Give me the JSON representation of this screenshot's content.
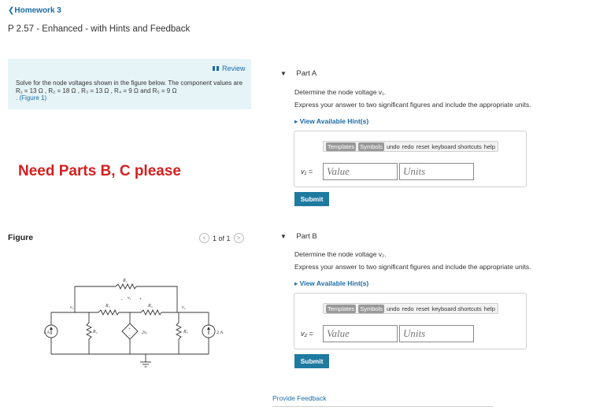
{
  "nav": {
    "back_label": "Homework 3"
  },
  "page": {
    "title": "P 2.57 - Enhanced - with Hints and Feedback"
  },
  "problem": {
    "review_label": "Review",
    "text_1": "Solve for the node voltages shown in the figure below. The component values are R₁ = 13 Ω , R₂ = 18 Ω , R₃ = 13 Ω , R₄ = 9 Ω and R₅ = 9 Ω",
    "text_prefix": ".",
    "figure_link": "(Figure 1)"
  },
  "overlay_note": "Need Parts B, C please",
  "figure": {
    "label": "Figure",
    "pager_text": "1 of 1",
    "prev_icon": "<",
    "next_icon": ">"
  },
  "circuit": {
    "src1": "1 A",
    "src2": "2 A",
    "r1": "R₁",
    "r2": "R₂",
    "r3": "R₃",
    "r4": "R₄",
    "r5": "R₅",
    "v1": "v₁",
    "v2": "v₂",
    "vx": "vₓ",
    "dep": "2vₓ",
    "plus": "+",
    "minus": "−"
  },
  "partA": {
    "title": "Part A",
    "prompt": "Determine the node voltage v₁.",
    "instruction": "Express your answer to two significant figures and include the appropriate units.",
    "hint_label": "View Available Hint(s)",
    "var_label": "v₁ =",
    "value_placeholder": "Value",
    "units_placeholder": "Units",
    "submit_label": "Submit"
  },
  "partB": {
    "title": "Part B",
    "prompt": "Determine the node voltage v₂.",
    "instruction": "Express your answer to two significant figures and include the appropriate units.",
    "hint_label": "View Available Hint(s)",
    "var_label": "v₂ =",
    "value_placeholder": "Value",
    "units_placeholder": "Units",
    "submit_label": "Submit"
  },
  "toolbar": {
    "templates": "Templates",
    "symbols": "Symbols",
    "undo": "undo",
    "redo": "redo",
    "reset": "reset",
    "keyboard": "keyboard shortcuts",
    "help": "help"
  },
  "feedback_label": "Provide Feedback"
}
